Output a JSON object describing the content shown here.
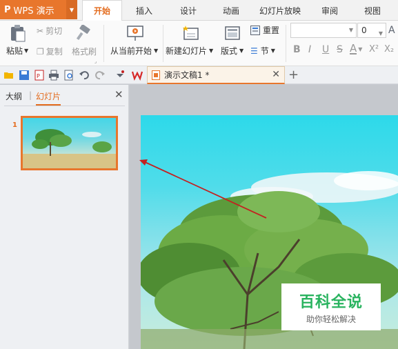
{
  "app": {
    "logo": "P",
    "name": "WPS 演示"
  },
  "tabs": [
    "开始",
    "插入",
    "设计",
    "动画",
    "幻灯片放映",
    "审阅",
    "视图"
  ],
  "ribbon": {
    "paste": "粘贴",
    "cut": "剪切",
    "copy": "复制",
    "format_painter": "格式刷",
    "from_current": "从当前开始",
    "new_slide": "新建幻灯片",
    "layout": "版式",
    "reset": "重置",
    "section": "节",
    "font_size": "0",
    "format_buttons": [
      "B",
      "I",
      "U",
      "S",
      "A",
      "X²",
      "X₂"
    ]
  },
  "doc_tab": {
    "name": "演示文稿1 *"
  },
  "side_panel": {
    "outline_tab": "大纲",
    "slides_tab": "幻灯片",
    "slide_number": "1"
  },
  "watermark": {
    "title": "百科全说",
    "subtitle": "助你轻松解决"
  },
  "colors": {
    "accent": "#e8762c",
    "active_tab_text": "#e36b1d",
    "watermark_green": "#29b35f",
    "arrow": "#c42020"
  }
}
